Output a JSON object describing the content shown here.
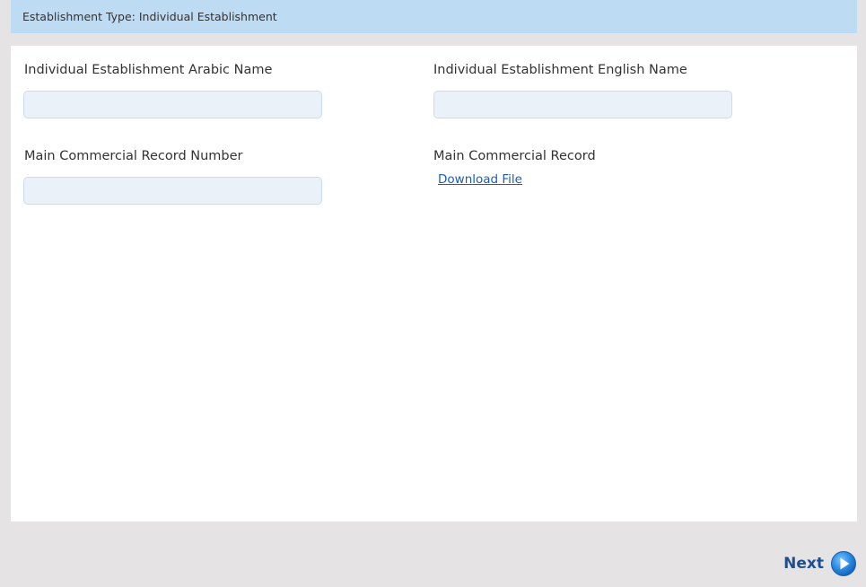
{
  "header": {
    "establishment_type": "Establishment Type: Individual Establishment"
  },
  "form": {
    "arabic_name": {
      "label": "Individual Establishment Arabic Name",
      "value": ""
    },
    "english_name": {
      "label": "Individual Establishment English Name",
      "value": ""
    },
    "cr_number": {
      "label": "Main Commercial Record Number",
      "value": ""
    },
    "main_cr": {
      "label": "Main Commercial Record",
      "link_text": "Download File"
    }
  },
  "footer": {
    "next_label": "Next"
  },
  "icons": {
    "next": "arrow-right-circle-icon"
  },
  "colors": {
    "header_bg": "#bddbf2",
    "input_bg": "#eaf1f8",
    "link": "#1a5fb4",
    "next_text": "#1f4f93",
    "page_bg": "#e6e3e4"
  }
}
